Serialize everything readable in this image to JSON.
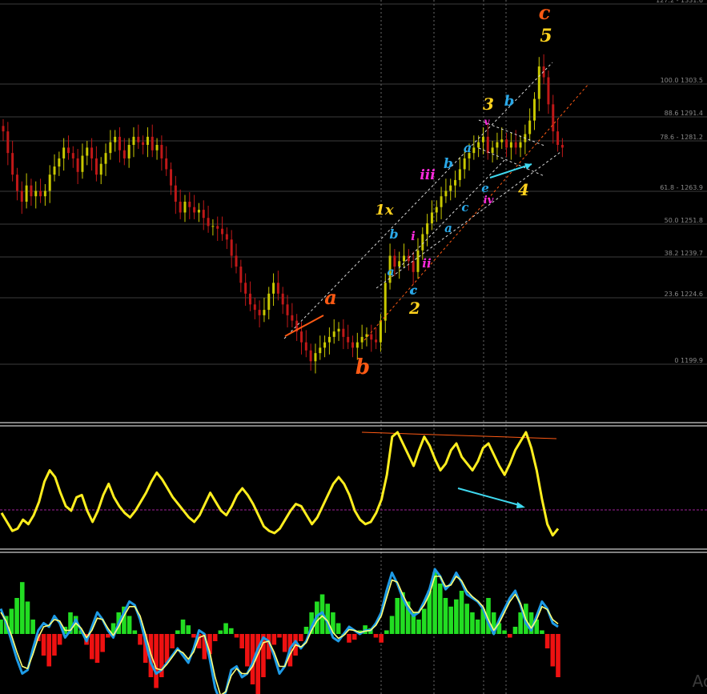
{
  "chart_data": [
    {
      "type": "candlestick",
      "title": "",
      "price_scale_labels": [
        "127.2 - 1331.6",
        "100.0 1303.5",
        "88.6 1291.4",
        "78.6 - 1281.2",
        "61.8 - 1263.9",
        "50.0 1251.8",
        "38.2 1239.7",
        "23.6 1224.6",
        "0 1199.9"
      ],
      "fib_levels": [
        {
          "ratio": 127.2,
          "label": "127.2 - 1331.6"
        },
        {
          "ratio": 100.0,
          "label": "100.0 1303.5"
        },
        {
          "ratio": 88.6,
          "label": "88.6 1291.4"
        },
        {
          "ratio": 78.6,
          "label": "78.6 - 1281.2"
        },
        {
          "ratio": 61.8,
          "label": "61.8 - 1263.9"
        },
        {
          "ratio": 50.0,
          "label": "50.0 1251.8"
        },
        {
          "ratio": 38.2,
          "label": "38.2 1239.7"
        },
        {
          "ratio": 23.6,
          "label": "23.6 1224.6"
        },
        {
          "ratio": 0,
          "label": "0 1199.9"
        }
      ],
      "wave_labels": [
        {
          "text": "c",
          "color": "#ff5a14"
        },
        {
          "text": "5",
          "color": "#ffd21e"
        },
        {
          "text": "3",
          "color": "#ffd21e"
        },
        {
          "text": "b",
          "color": "#2aa8e8"
        },
        {
          "text": "v",
          "color": "#ff2adf"
        },
        {
          "text": "a",
          "color": "#2aa8e8"
        },
        {
          "text": "b",
          "color": "#2aa8e8"
        },
        {
          "text": "iii",
          "color": "#ff2adf"
        },
        {
          "text": "c",
          "color": "#2aa8e8"
        },
        {
          "text": "e",
          "color": "#2aa8e8"
        },
        {
          "text": "iv",
          "color": "#ff2adf"
        },
        {
          "text": "4",
          "color": "#ffd21e"
        },
        {
          "text": "c",
          "color": "#2aa8e8"
        },
        {
          "text": "a",
          "color": "#2aa8e8"
        },
        {
          "text": "1x",
          "color": "#ffd21e"
        },
        {
          "text": "b",
          "color": "#2aa8e8"
        },
        {
          "text": "i",
          "color": "#ff2adf"
        },
        {
          "text": "a",
          "color": "#2aa8e8"
        },
        {
          "text": "ii",
          "color": "#ff2adf"
        },
        {
          "text": "c",
          "color": "#2aa8e8"
        },
        {
          "text": "2",
          "color": "#ffd21e"
        },
        {
          "text": "a",
          "color": "#ff5a14"
        },
        {
          "text": "b",
          "color": "#ff5a14"
        }
      ],
      "series": [
        {
          "name": "",
          "close": [
            1286,
            1278,
            1270,
            1264,
            1260,
            1266,
            1262,
            1264,
            1262,
            1264,
            1270,
            1273,
            1276,
            1280,
            1278,
            1276,
            1271,
            1277,
            1280,
            1276,
            1270,
            1274,
            1278,
            1282,
            1284,
            1279,
            1276,
            1281,
            1284,
            1282,
            1281,
            1284,
            1279,
            1281,
            1276,
            1272,
            1266,
            1260,
            1256,
            1260,
            1258,
            1256,
            1257,
            1254,
            1251,
            1251,
            1250,
            1248,
            1246,
            1240,
            1236,
            1230,
            1226,
            1222,
            1220,
            1218,
            1220,
            1226,
            1230,
            1226,
            1222,
            1218,
            1216,
            1212,
            1208,
            1205,
            1201,
            1204,
            1206,
            1208,
            1210,
            1212,
            1213,
            1210,
            1208,
            1206,
            1208,
            1210,
            1211,
            1209,
            1208,
            1216,
            1230,
            1240,
            1236,
            1238,
            1240,
            1238,
            1234,
            1242,
            1248,
            1252,
            1256,
            1258,
            1262,
            1264,
            1266,
            1268,
            1272,
            1276,
            1278,
            1280,
            1282,
            1284,
            1278,
            1280,
            1282,
            1283,
            1280,
            1282,
            1280,
            1282,
            1285,
            1290,
            1298,
            1310,
            1306,
            1296,
            1286,
            1281,
            1280
          ]
        }
      ],
      "annotation_arrow_color": "#3fd9f0",
      "channel_colors": [
        "#ffffff",
        "#ff5a14"
      ]
    },
    {
      "type": "line",
      "title": "",
      "ylim": [
        0,
        100
      ],
      "reference_line": 22,
      "series": [
        {
          "name": "",
          "color": "#ffee1e",
          "values": [
            28,
            20,
            12,
            14,
            22,
            18,
            26,
            38,
            56,
            66,
            60,
            46,
            34,
            30,
            42,
            44,
            30,
            20,
            30,
            44,
            54,
            42,
            34,
            28,
            24,
            30,
            38,
            46,
            56,
            64,
            58,
            50,
            42,
            36,
            30,
            24,
            20,
            26,
            36,
            46,
            38,
            30,
            26,
            34,
            44,
            50,
            44,
            36,
            26,
            16,
            12,
            10,
            14,
            22,
            30,
            36,
            34,
            26,
            18,
            24,
            34,
            44,
            54,
            60,
            54,
            44,
            30,
            22,
            18,
            20,
            28,
            40,
            62,
            96,
            100,
            90,
            80,
            70,
            84,
            96,
            88,
            76,
            66,
            72,
            84,
            90,
            78,
            72,
            66,
            74,
            86,
            90,
            80,
            70,
            62,
            72,
            84,
            92,
            100,
            86,
            66,
            40,
            18,
            8,
            14
          ]
        }
      ]
    },
    {
      "type": "bar",
      "title": "",
      "ylim": [
        -1,
        1
      ],
      "series": [
        {
          "name": "",
          "color_positive": "#22dd22",
          "color_negative": "#ee1111",
          "values": [
            0.2,
            0.25,
            0.35,
            0.5,
            0.72,
            0.45,
            0.2,
            -0.1,
            -0.3,
            -0.45,
            -0.3,
            -0.15,
            0.1,
            0.3,
            0.25,
            0.05,
            -0.15,
            -0.35,
            -0.4,
            -0.25,
            -0.05,
            0.15,
            0.3,
            0.38,
            0.25,
            0.05,
            -0.15,
            -0.4,
            -0.6,
            -0.75,
            -0.6,
            -0.4,
            -0.2,
            0.05,
            0.2,
            0.12,
            -0.05,
            -0.2,
            -0.35,
            -0.28,
            -0.1,
            0.05,
            0.15,
            0.08,
            -0.05,
            -0.2,
            -0.45,
            -0.7,
            -0.85,
            -0.6,
            -0.35,
            -0.15,
            -0.05,
            -0.25,
            -0.45,
            -0.3,
            -0.1,
            0.1,
            0.3,
            0.45,
            0.55,
            0.42,
            0.3,
            0.15,
            0.0,
            -0.12,
            -0.08,
            0.05,
            0.12,
            0.08,
            -0.05,
            -0.12,
            0.05,
            0.25,
            0.5,
            0.58,
            0.45,
            0.3,
            0.2,
            0.35,
            0.6,
            0.86,
            0.7,
            0.5,
            0.38,
            0.48,
            0.6,
            0.42,
            0.3,
            0.2,
            0.35,
            0.5,
            0.3,
            0.15,
            0.05,
            -0.05,
            0.1,
            0.3,
            0.42,
            0.3,
            0.2,
            0.05,
            -0.2,
            -0.45,
            -0.6
          ]
        },
        {
          "name": "",
          "color": "#1e9be6",
          "values": [
            0.35,
            0.15,
            -0.1,
            -0.35,
            -0.55,
            -0.5,
            -0.2,
            0.05,
            0.15,
            0.1,
            0.25,
            0.15,
            -0.05,
            0.05,
            0.2,
            0.05,
            -0.1,
            0.1,
            0.3,
            0.2,
            0.05,
            -0.05,
            0.15,
            0.3,
            0.45,
            0.4,
            0.2,
            -0.1,
            -0.4,
            -0.55,
            -0.5,
            -0.4,
            -0.3,
            -0.2,
            -0.3,
            -0.4,
            -0.2,
            0.05,
            0.0,
            -0.35,
            -0.75,
            -0.95,
            -0.8,
            -0.5,
            -0.45,
            -0.6,
            -0.55,
            -0.4,
            -0.2,
            -0.05,
            -0.1,
            -0.3,
            -0.55,
            -0.45,
            -0.2,
            -0.1,
            -0.2,
            -0.1,
            0.1,
            0.25,
            0.3,
            0.15,
            -0.05,
            -0.1,
            0.0,
            0.1,
            0.05,
            0.0,
            0.05,
            0.05,
            0.15,
            0.3,
            0.6,
            0.85,
            0.7,
            0.5,
            0.35,
            0.25,
            0.3,
            0.45,
            0.62,
            0.9,
            0.8,
            0.62,
            0.7,
            0.85,
            0.72,
            0.55,
            0.5,
            0.45,
            0.35,
            0.15,
            0.0,
            0.2,
            0.35,
            0.5,
            0.6,
            0.4,
            0.15,
            0.05,
            0.25,
            0.45,
            0.35,
            0.15,
            0.1
          ]
        },
        {
          "name": "",
          "color": "#ffff78",
          "values": [
            0.3,
            0.18,
            -0.02,
            -0.25,
            -0.45,
            -0.48,
            -0.28,
            -0.05,
            0.1,
            0.12,
            0.2,
            0.18,
            0.05,
            0.05,
            0.15,
            0.08,
            -0.05,
            0.05,
            0.22,
            0.2,
            0.08,
            -0.02,
            0.1,
            0.25,
            0.38,
            0.38,
            0.25,
            0.0,
            -0.28,
            -0.48,
            -0.5,
            -0.42,
            -0.32,
            -0.22,
            -0.26,
            -0.35,
            -0.25,
            -0.05,
            -0.02,
            -0.25,
            -0.6,
            -0.85,
            -0.8,
            -0.58,
            -0.48,
            -0.55,
            -0.55,
            -0.45,
            -0.28,
            -0.12,
            -0.1,
            -0.25,
            -0.45,
            -0.45,
            -0.28,
            -0.15,
            -0.18,
            -0.12,
            0.05,
            0.18,
            0.25,
            0.18,
            0.02,
            -0.06,
            -0.02,
            0.06,
            0.05,
            0.02,
            0.04,
            0.05,
            0.12,
            0.25,
            0.5,
            0.75,
            0.72,
            0.55,
            0.4,
            0.3,
            0.3,
            0.4,
            0.55,
            0.8,
            0.8,
            0.66,
            0.68,
            0.8,
            0.74,
            0.6,
            0.52,
            0.46,
            0.38,
            0.2,
            0.05,
            0.15,
            0.3,
            0.45,
            0.55,
            0.42,
            0.2,
            0.08,
            0.2,
            0.38,
            0.34,
            0.2,
            0.14
          ]
        }
      ]
    }
  ]
}
